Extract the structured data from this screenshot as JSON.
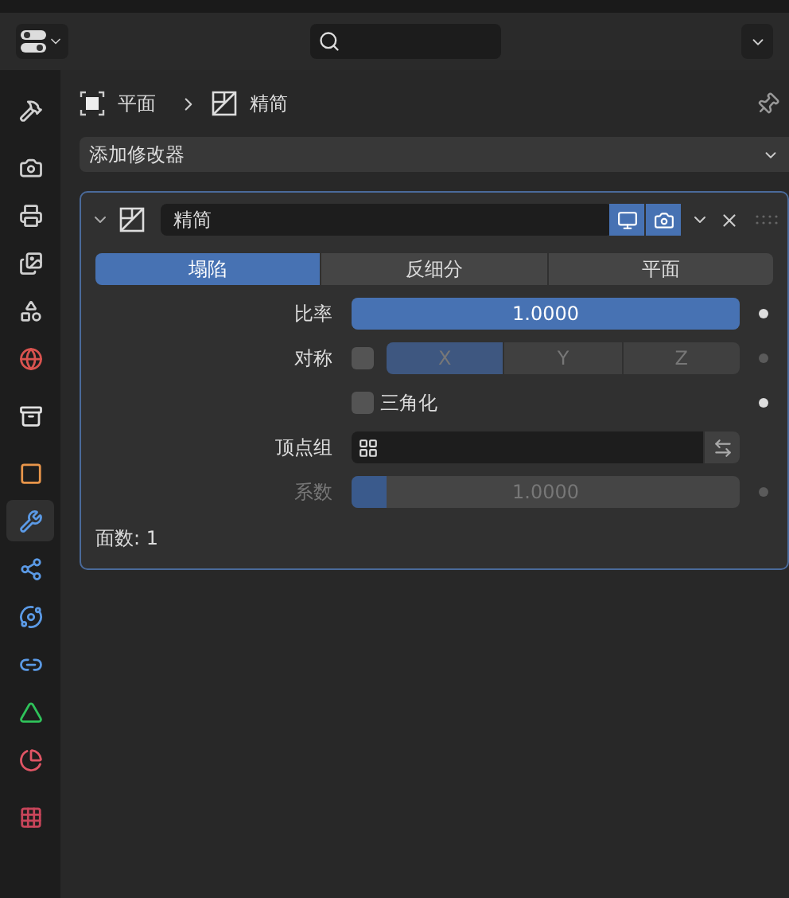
{
  "sidebar": {
    "groups": [
      {
        "items": [
          {
            "kind": "tool",
            "selected": false,
            "color": "#d0d0d0"
          }
        ]
      },
      {
        "items": [
          {
            "kind": "render",
            "selected": false,
            "color": "#cfcfcf"
          },
          {
            "kind": "output",
            "selected": false,
            "color": "#cfcfcf"
          },
          {
            "kind": "view_layer",
            "selected": false,
            "color": "#cfcfcf"
          },
          {
            "kind": "scene",
            "selected": false,
            "color": "#cfcfcf"
          },
          {
            "kind": "world",
            "selected": false,
            "color": "#d9534f"
          }
        ]
      },
      {
        "items": [
          {
            "kind": "collection",
            "selected": false,
            "color": "#e0e0e0"
          }
        ]
      },
      {
        "items": [
          {
            "kind": "object",
            "selected": false,
            "color": "#e8954a"
          },
          {
            "kind": "modifier",
            "selected": true,
            "color": "#5b9ae6"
          },
          {
            "kind": "particles",
            "selected": false,
            "color": "#5b9ae6"
          },
          {
            "kind": "physics",
            "selected": false,
            "color": "#5b9ae6"
          },
          {
            "kind": "constraints",
            "selected": false,
            "color": "#5b9ae6"
          },
          {
            "kind": "data",
            "selected": false,
            "color": "#2fc25a"
          },
          {
            "kind": "material",
            "selected": false,
            "color": "#e05565"
          }
        ]
      },
      {
        "items": [
          {
            "kind": "texture",
            "selected": false,
            "color": "#c8455a"
          }
        ]
      }
    ]
  },
  "breadcrumb": [
    {
      "kind": "object",
      "label": "平面"
    },
    {
      "kind": "modifier",
      "label": "精简"
    }
  ],
  "add_modifier": {
    "label": "添加修改器"
  },
  "modifier": {
    "name": "精简",
    "expanded": true,
    "show_viewport": true,
    "show_render": true,
    "modes": [
      {
        "label": "塌陷",
        "selected": true
      },
      {
        "label": "反细分",
        "selected": false
      },
      {
        "label": "平面",
        "selected": false
      }
    ],
    "fields": [
      {
        "kind": "slider",
        "label": "比率",
        "value": "1.0000",
        "level": 1,
        "disabled": false
      },
      {
        "kind": "axes",
        "label": "对称",
        "checked": false,
        "disabled": true,
        "axes": [
          {
            "label": "X",
            "selected": true
          },
          {
            "label": "Y",
            "selected": false
          },
          {
            "label": "Z",
            "selected": false
          }
        ]
      },
      {
        "kind": "checkbox",
        "label": "三角化",
        "checked": false
      },
      {
        "kind": "group",
        "label": "顶点组"
      },
      {
        "kind": "slider",
        "label": "系数",
        "value": "1.0000",
        "level": 0.09,
        "disabled": true
      }
    ],
    "face_count": "面数: 1"
  }
}
